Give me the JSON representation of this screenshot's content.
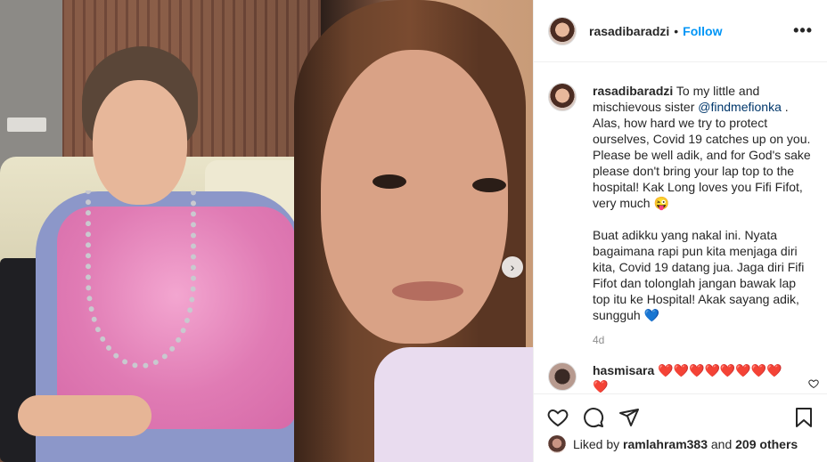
{
  "post": {
    "username": "rasadibaradzi",
    "dot": "•",
    "follow_label": "Follow",
    "more_label": "•••"
  },
  "caption": {
    "username": "rasadibaradzi",
    "text_before_mention": "To my little and mischievous sister",
    "mention": "@findmefionka",
    "text_after_mention": ". Alas, how hard we try to protect ourselves, Covid 19 catches up on you. Please be well adik, and for God's sake please don't bring your lap top to the hospital! Kak Long loves you Fifi Fifot, very much 😜",
    "paragraph2": "Buat adikku yang nakal ini. Nyata bagaimana rapi pun kita menjaga diri kita, Covid 19 datang jua. Jaga diri Fifi Fifot dan tolonglah jangan bawak lap top itu ke Hospital! Akak sayang adik, sungguh 💙",
    "age": "4d"
  },
  "comment": {
    "username": "hasmisara",
    "text": "❤️❤️❤️❤️❤️❤️❤️❤️❤️"
  },
  "likes": {
    "prefix": "Liked by",
    "user": "ramlahram383",
    "joiner": "and",
    "others": "209 others"
  },
  "icons": {
    "carousel_next": "chevron-right-icon",
    "like": "heart-icon",
    "comment": "comment-icon",
    "share": "paper-plane-icon",
    "save": "bookmark-icon",
    "comment_like": "heart-icon"
  }
}
